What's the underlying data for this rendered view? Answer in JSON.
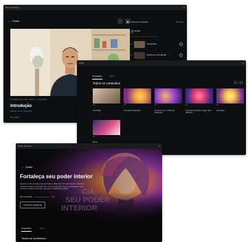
{
  "window1": {
    "title": "Nome do curso",
    "back_label": "Voltar",
    "side_title": "Lista de Conteúdos",
    "side_action": "Recolher",
    "module_label": "Introdução",
    "module_meta": "0/2",
    "lessons": [
      {
        "label": "Introdução"
      },
      {
        "label": "Prática de Introdução"
      }
    ],
    "video_meta": "Fortaleça seu poder interior · Introdução",
    "video_title": "Introdução",
    "video_link": "Marcar como concluída",
    "description_label": "Descrição"
  },
  "window2": {
    "title": "Início",
    "tabs": [
      "Conteúdos",
      "Sobre"
    ],
    "section_title": "Todos os conteúdos",
    "cards": [
      {
        "caption": "Introdução",
        "meta": "0/2",
        "colors": [
          "#d8c4a8",
          "#6d5a45"
        ]
      },
      {
        "caption": "O Despertar Espiritual",
        "meta": "0/1",
        "colors": [
          "#f0a23a",
          "#7b2f8c"
        ]
      },
      {
        "caption": "A Luta do Ser e o Nível de Diferenças",
        "meta": "0/1",
        "colors": [
          "#8a3fcf",
          "#ff7b39"
        ]
      },
      {
        "caption": "O Mundo Da Ilusão e o Ego / Eles Ofendem",
        "meta": "0/1",
        "colors": [
          "#e83f6f",
          "#3a2a8f"
        ]
      },
      {
        "caption": "Conclusão",
        "meta": "0/1",
        "colors": [
          "#f9c34a",
          "#6b2d8f"
        ]
      },
      {
        "caption": "Bônus",
        "meta": "0/1",
        "colors": [
          "#2b2f6a",
          "#e0518a"
        ]
      }
    ]
  },
  "window3": {
    "title": "Nome do curso",
    "back_label": "Voltar",
    "hero_title": "Fortaleça seu poder interior",
    "hero_description": "Aprenda a fazer escolhas mais acertadas e eficientes, com mais clareza e propósito, a partir da visão do seu próprio Ser e de sua essência. O que é a autoestima, como entender e aplicá-la, técnicas, exercícios e meditações guiadas.",
    "hero_overlay": [
      "CIA",
      "SEU PODER",
      "INTERIOR"
    ],
    "progress_label": "0% concluído",
    "progress_count": "0/8",
    "progress_value": 0,
    "continue_label": "Continuar assistindo",
    "tabs": [
      "Conteúdos",
      "Sobre"
    ],
    "section_title": "Todos os conteúdos"
  },
  "icons": [
    "arrow-left-icon",
    "ellipsis-icon",
    "expand-icon",
    "checkmark-circle-icon",
    "grid-view-icon",
    "list-view-icon"
  ],
  "colors": {
    "background": "#0e0f10",
    "accent": "#4a8fe0",
    "surface": "#1b1c1e"
  }
}
